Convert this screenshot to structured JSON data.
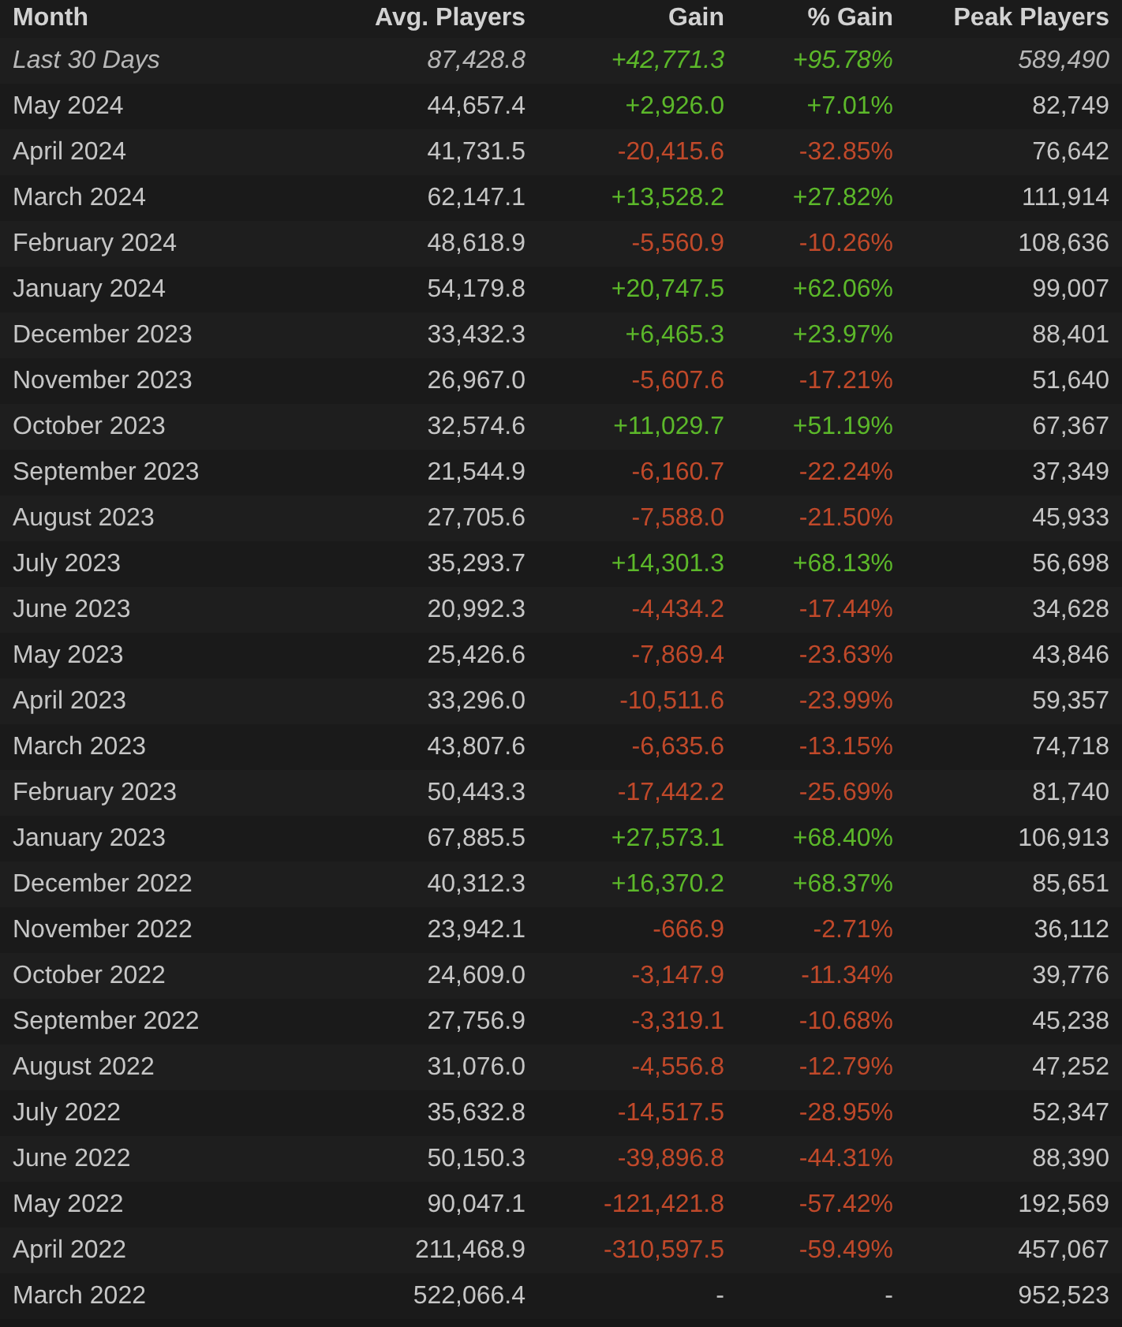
{
  "table": {
    "columns": [
      "Month",
      "Avg. Players",
      "Gain",
      "% Gain",
      "Peak Players"
    ],
    "rows": [
      {
        "month": "Last 30 Days",
        "avg": "87,428.8",
        "gain": "+42,771.3",
        "pct": "+95.78%",
        "peak": "589,490",
        "kind": "summary",
        "color": "#5cb82a"
      },
      {
        "month": "May 2024",
        "avg": "44,657.4",
        "gain": "+2,926.0",
        "pct": "+7.01%",
        "peak": "82,749",
        "kind": "month",
        "color": "#5cb82a"
      },
      {
        "month": "April 2024",
        "avg": "41,731.5",
        "gain": "-20,415.6",
        "pct": "-32.85%",
        "peak": "76,642",
        "kind": "month",
        "color": "#c0492a"
      },
      {
        "month": "March 2024",
        "avg": "62,147.1",
        "gain": "+13,528.2",
        "pct": "+27.82%",
        "peak": "111,914",
        "kind": "month",
        "color": "#5cb82a"
      },
      {
        "month": "February 2024",
        "avg": "48,618.9",
        "gain": "-5,560.9",
        "pct": "-10.26%",
        "peak": "108,636",
        "kind": "month",
        "color": "#c0492a"
      },
      {
        "month": "January 2024",
        "avg": "54,179.8",
        "gain": "+20,747.5",
        "pct": "+62.06%",
        "peak": "99,007",
        "kind": "month",
        "color": "#5cb82a"
      },
      {
        "month": "December 2023",
        "avg": "33,432.3",
        "gain": "+6,465.3",
        "pct": "+23.97%",
        "peak": "88,401",
        "kind": "month",
        "color": "#5cb82a"
      },
      {
        "month": "November 2023",
        "avg": "26,967.0",
        "gain": "-5,607.6",
        "pct": "-17.21%",
        "peak": "51,640",
        "kind": "month",
        "color": "#c0492a"
      },
      {
        "month": "October 2023",
        "avg": "32,574.6",
        "gain": "+11,029.7",
        "pct": "+51.19%",
        "peak": "67,367",
        "kind": "month",
        "color": "#5cb82a"
      },
      {
        "month": "September 2023",
        "avg": "21,544.9",
        "gain": "-6,160.7",
        "pct": "-22.24%",
        "peak": "37,349",
        "kind": "month",
        "color": "#c0492a"
      },
      {
        "month": "August 2023",
        "avg": "27,705.6",
        "gain": "-7,588.0",
        "pct": "-21.50%",
        "peak": "45,933",
        "kind": "month",
        "color": "#c0492a"
      },
      {
        "month": "July 2023",
        "avg": "35,293.7",
        "gain": "+14,301.3",
        "pct": "+68.13%",
        "peak": "56,698",
        "kind": "month",
        "color": "#5cb82a"
      },
      {
        "month": "June 2023",
        "avg": "20,992.3",
        "gain": "-4,434.2",
        "pct": "-17.44%",
        "peak": "34,628",
        "kind": "month",
        "color": "#c0492a"
      },
      {
        "month": "May 2023",
        "avg": "25,426.6",
        "gain": "-7,869.4",
        "pct": "-23.63%",
        "peak": "43,846",
        "kind": "month",
        "color": "#c0492a"
      },
      {
        "month": "April 2023",
        "avg": "33,296.0",
        "gain": "-10,511.6",
        "pct": "-23.99%",
        "peak": "59,357",
        "kind": "month",
        "color": "#c0492a"
      },
      {
        "month": "March 2023",
        "avg": "43,807.6",
        "gain": "-6,635.6",
        "pct": "-13.15%",
        "peak": "74,718",
        "kind": "month",
        "color": "#c0492a"
      },
      {
        "month": "February 2023",
        "avg": "50,443.3",
        "gain": "-17,442.2",
        "pct": "-25.69%",
        "peak": "81,740",
        "kind": "month",
        "color": "#c0492a"
      },
      {
        "month": "January 2023",
        "avg": "67,885.5",
        "gain": "+27,573.1",
        "pct": "+68.40%",
        "peak": "106,913",
        "kind": "month",
        "color": "#5cb82a"
      },
      {
        "month": "December 2022",
        "avg": "40,312.3",
        "gain": "+16,370.2",
        "pct": "+68.37%",
        "peak": "85,651",
        "kind": "month",
        "color": "#5cb82a"
      },
      {
        "month": "November 2022",
        "avg": "23,942.1",
        "gain": "-666.9",
        "pct": "-2.71%",
        "peak": "36,112",
        "kind": "month",
        "color": "#c0492a"
      },
      {
        "month": "October 2022",
        "avg": "24,609.0",
        "gain": "-3,147.9",
        "pct": "-11.34%",
        "peak": "39,776",
        "kind": "month",
        "color": "#c0492a"
      },
      {
        "month": "September 2022",
        "avg": "27,756.9",
        "gain": "-3,319.1",
        "pct": "-10.68%",
        "peak": "45,238",
        "kind": "month",
        "color": "#c0492a"
      },
      {
        "month": "August 2022",
        "avg": "31,076.0",
        "gain": "-4,556.8",
        "pct": "-12.79%",
        "peak": "47,252",
        "kind": "month",
        "color": "#c0492a"
      },
      {
        "month": "July 2022",
        "avg": "35,632.8",
        "gain": "-14,517.5",
        "pct": "-28.95%",
        "peak": "52,347",
        "kind": "month",
        "color": "#c0492a"
      },
      {
        "month": "June 2022",
        "avg": "50,150.3",
        "gain": "-39,896.8",
        "pct": "-44.31%",
        "peak": "88,390",
        "kind": "month",
        "color": "#c0492a"
      },
      {
        "month": "May 2022",
        "avg": "90,047.1",
        "gain": "-121,421.8",
        "pct": "-57.42%",
        "peak": "192,569",
        "kind": "month",
        "color": "#c0492a"
      },
      {
        "month": "April 2022",
        "avg": "211,468.9",
        "gain": "-310,597.5",
        "pct": "-59.49%",
        "peak": "457,067",
        "kind": "month",
        "color": "#c0492a"
      },
      {
        "month": "March 2022",
        "avg": "522,066.4",
        "gain": "-",
        "pct": "-",
        "peak": "952,523",
        "kind": "month"
      }
    ]
  }
}
